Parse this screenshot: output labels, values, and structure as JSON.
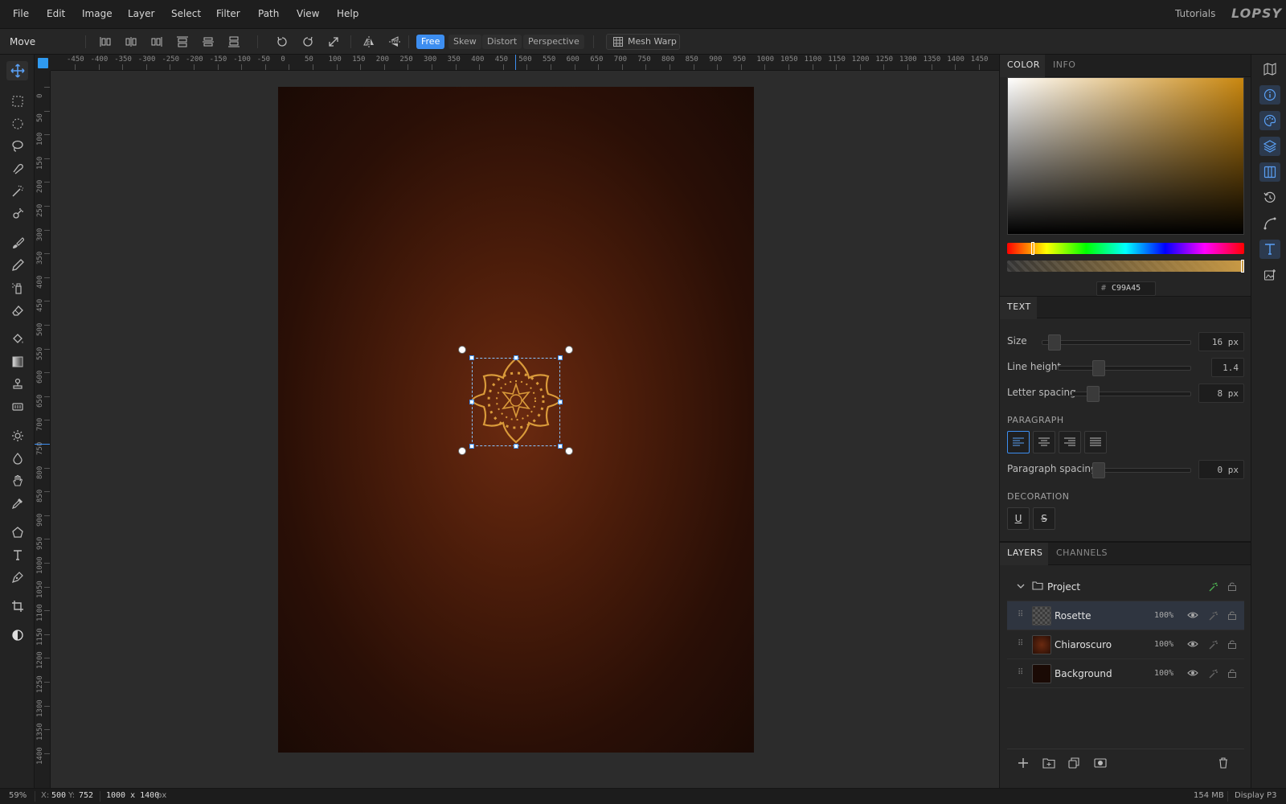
{
  "menu": {
    "items": [
      "File",
      "Edit",
      "Image",
      "Layer",
      "Select",
      "Filter",
      "Path",
      "View",
      "Help"
    ],
    "tutorials": "Tutorials",
    "logo": "LOPSY"
  },
  "options": {
    "tool_name": "Move",
    "transform_modes": [
      "Free",
      "Skew",
      "Distort",
      "Perspective"
    ],
    "active_mode": "Free",
    "mesh_warp": "Mesh Warp"
  },
  "rulers": {
    "top": [
      "-450",
      "-400",
      "-350",
      "-300",
      "-250",
      "-200",
      "-150",
      "-100",
      "-50",
      "0",
      "50",
      "100",
      "150",
      "200",
      "250",
      "300",
      "350",
      "400",
      "450",
      "500",
      "550",
      "600",
      "650",
      "700",
      "750",
      "800",
      "850",
      "900",
      "950",
      "1000",
      "1050",
      "1100",
      "1150",
      "1200",
      "1250",
      "1300",
      "1350",
      "1400",
      "1450"
    ],
    "left": [
      "0",
      "50",
      "100",
      "150",
      "200",
      "250",
      "300",
      "350",
      "400",
      "450",
      "500",
      "550",
      "600",
      "650",
      "700",
      "750",
      "800",
      "850",
      "900",
      "950",
      "1000",
      "1050",
      "1100",
      "1150",
      "1200",
      "1250",
      "1300",
      "1350",
      "1400"
    ]
  },
  "color_panel": {
    "tabs": [
      "COLOR",
      "INFO"
    ],
    "hex_label": "#",
    "hex": "C99A45",
    "accent": "#3d8ef0",
    "current_color": "#c99a45"
  },
  "text_panel": {
    "tab": "TEXT",
    "size_label": "Size",
    "size_value": "16 px",
    "line_height_label": "Line height",
    "line_height_value": "1.4",
    "letter_spacing_label": "Letter spacing",
    "letter_spacing_value": "8 px",
    "paragraph_title": "PARAGRAPH",
    "paragraph_spacing_label": "Paragraph spacing",
    "paragraph_spacing_value": "0 px",
    "decoration_title": "DECORATION",
    "underline": "U",
    "strike": "S"
  },
  "layers_panel": {
    "tabs": [
      "LAYERS",
      "CHANNELS"
    ],
    "group": "Project",
    "layers": [
      {
        "name": "Rosette",
        "opacity": "100%"
      },
      {
        "name": "Chiaroscuro",
        "opacity": "100%"
      },
      {
        "name": "Background",
        "opacity": "100%"
      }
    ]
  },
  "status": {
    "zoom": "59%",
    "coords_x_label": "X:",
    "coords_x": "500",
    "coords_y_label": "Y:",
    "coords_y": "752",
    "doc_size": "1000 x 1400",
    "doc_unit": "px",
    "memory": "154 MB",
    "profile": "Display P3"
  }
}
